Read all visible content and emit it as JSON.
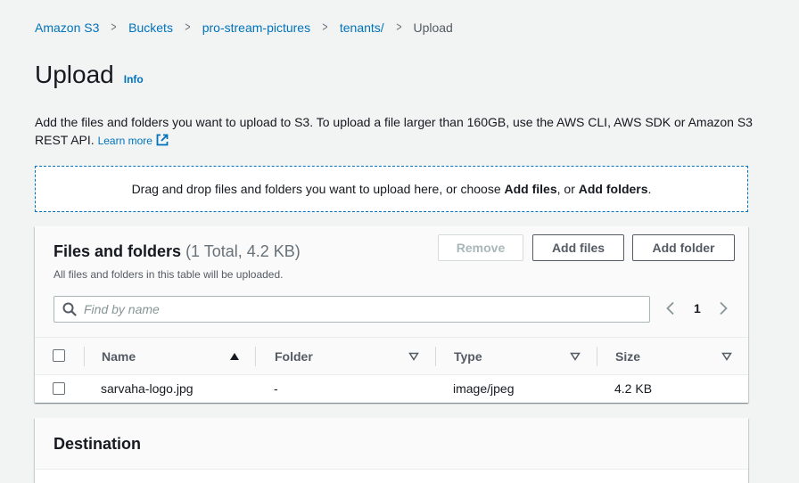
{
  "breadcrumb": {
    "items": [
      "Amazon S3",
      "Buckets",
      "pro-stream-pictures",
      "tenants/",
      "Upload"
    ]
  },
  "page": {
    "title": "Upload",
    "info_label": "Info",
    "description": "Add the files and folders you want to upload to S3. To upload a file larger than 160GB, use the AWS CLI, AWS SDK or Amazon S3 REST API.",
    "learn_more": "Learn more"
  },
  "dropzone": {
    "text_before": "Drag and drop files and folders you want to upload here, or choose ",
    "add_files": "Add files",
    "text_middle": ", or ",
    "add_folders": "Add folders",
    "text_after": "."
  },
  "files_panel": {
    "title": "Files and folders",
    "count": "(1 Total, 4.2 KB)",
    "subtitle": "All files and folders in this table will be uploaded.",
    "remove_label": "Remove",
    "add_files_label": "Add files",
    "add_folder_label": "Add folder",
    "search_placeholder": "Find by name",
    "current_page": "1",
    "columns": [
      "Name",
      "Folder",
      "Type",
      "Size"
    ],
    "rows": [
      {
        "name": "sarvaha-logo.jpg",
        "folder": "-",
        "type": "image/jpeg",
        "size": "4.2 KB"
      }
    ]
  },
  "destination": {
    "title": "Destination"
  },
  "colors": {
    "link": "#0073bb",
    "background": "#f2f3f3",
    "panel_header": "#fafafa",
    "text": "#16191f"
  },
  "icons": [
    "chevron-right-icon",
    "external-link-icon",
    "search-icon",
    "chevron-left-icon",
    "sort-ascending-icon",
    "sort-descending-icon"
  ]
}
